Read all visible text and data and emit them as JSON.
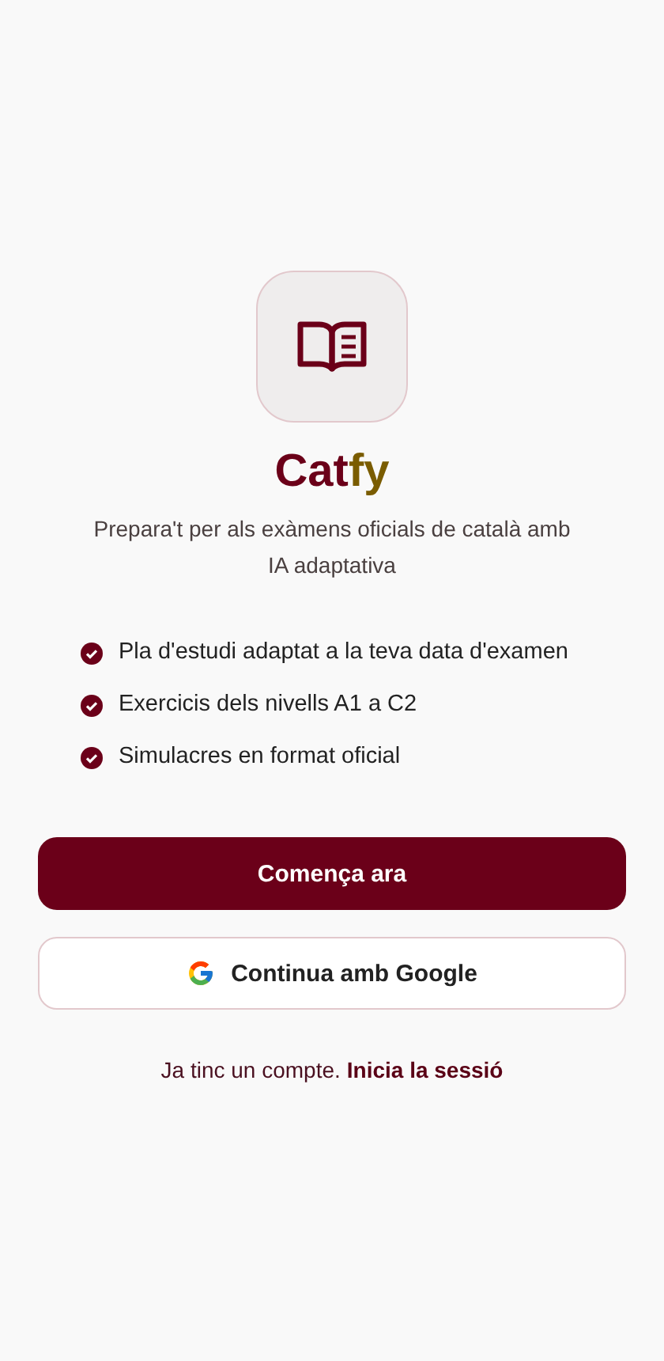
{
  "logo": {
    "first": "Cat",
    "second": "fy"
  },
  "tagline": "Prepara't per als exàmens oficials de català amb IA adaptativa",
  "features": [
    "Pla d'estudi adaptat a la teva data d'examen",
    "Exercicis dels nivells A1 a C2",
    "Simulacres en format oficial"
  ],
  "buttons": [
    {
      "kind": "primary",
      "label": "Comença ara"
    },
    {
      "kind": "google",
      "label": "Continua amb Google"
    }
  ],
  "footer": {
    "text": "Ja tinc un compte.",
    "link": "Inicia la sessió"
  }
}
